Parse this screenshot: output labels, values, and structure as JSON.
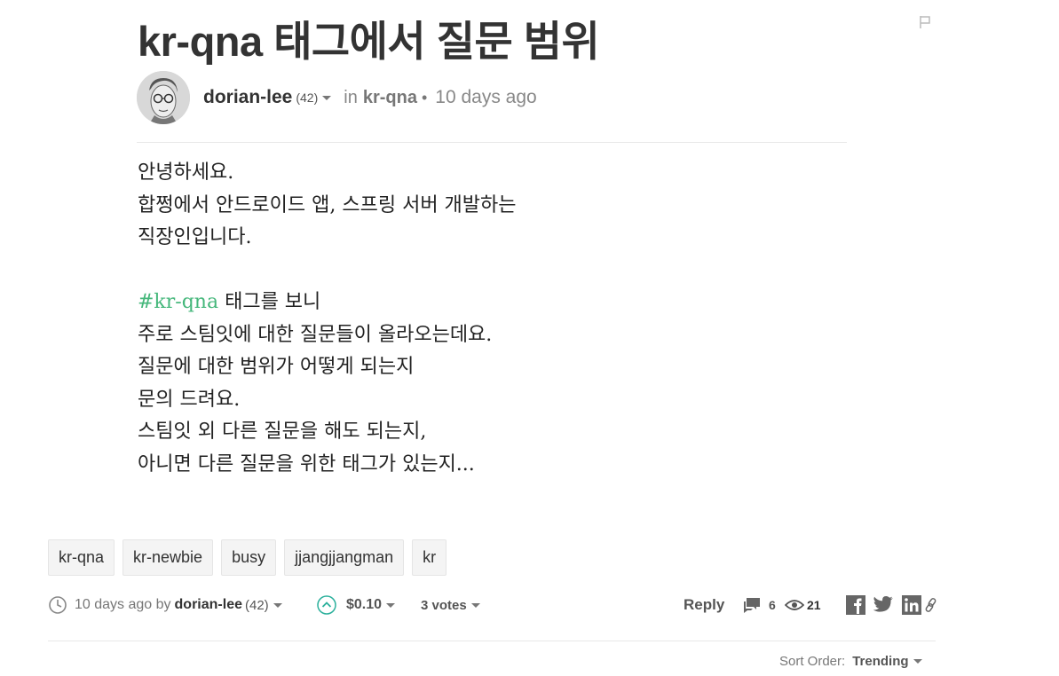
{
  "post": {
    "title": "kr-qna 태그에서 질문 범위",
    "author": "dorian-lee",
    "author_rep": "(42)",
    "in_word": "in",
    "category": "kr-qna",
    "time": "10 days ago"
  },
  "body_lines": [
    "안녕하세요.",
    "합쩡에서 안드로이드 앱, 스프링 서버 개발하는",
    "직장인입니다.",
    "",
    "#kr-qna",
    "주로 스팀잇에 대한 질문들이 올라오는데요.",
    "질문에 대한 범위가 어떻게 되는지",
    "문의 드려요.",
    "스팀잇 외 다른 질문을 해도 되는지,",
    "아니면 다른 질문을 위한 태그가 있는지..."
  ],
  "hashtag_line_rest": " 태그를 보니",
  "tags": [
    "kr-qna",
    "kr-newbie",
    "busy",
    "jjangjjangman",
    "kr"
  ],
  "footer": {
    "time": "10 days ago by",
    "author": "dorian-lee",
    "author_rep": "(42)",
    "payout": "$0.10",
    "votes": "3 votes",
    "reply": "Reply",
    "comments": "6",
    "views": "21"
  },
  "sort": {
    "label": "Sort Order:",
    "value": "Trending"
  },
  "icons": {
    "flag": "flag-icon",
    "clock": "clock-icon",
    "upvote": "upvote-icon",
    "comments": "comments-icon",
    "views": "eye-icon",
    "facebook": "facebook-icon",
    "twitter": "twitter-icon",
    "linkedin": "linkedin-icon",
    "link": "link-icon"
  },
  "colors": {
    "hashtag": "#45b77b",
    "text": "#333333",
    "muted": "#888888",
    "upvote": "#2bb09c"
  }
}
